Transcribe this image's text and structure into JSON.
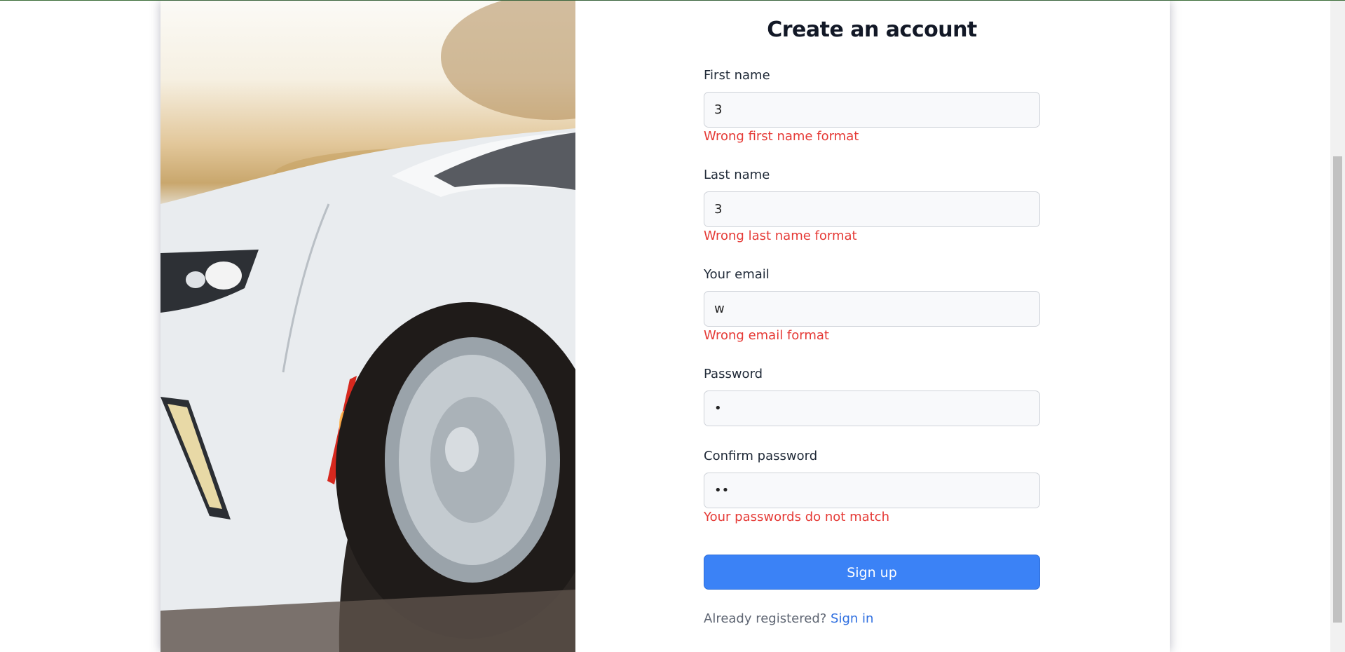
{
  "form": {
    "title": "Create an account",
    "first_name": {
      "label": "First name",
      "value": "3",
      "error": "Wrong first name format"
    },
    "last_name": {
      "label": "Last name",
      "value": "3",
      "error": "Wrong last name format"
    },
    "email": {
      "label": "Your email",
      "value": "w",
      "error": "Wrong email format"
    },
    "password": {
      "label": "Password",
      "value": "•"
    },
    "confirm_password": {
      "label": "Confirm password",
      "value": "••",
      "error": "Your passwords do not match"
    },
    "submit_label": "Sign up",
    "footer_text": "Already registered?",
    "footer_link": "Sign in"
  },
  "colors": {
    "primary": "#3b82f6",
    "error": "#e53935",
    "link": "#2f6fe0"
  }
}
